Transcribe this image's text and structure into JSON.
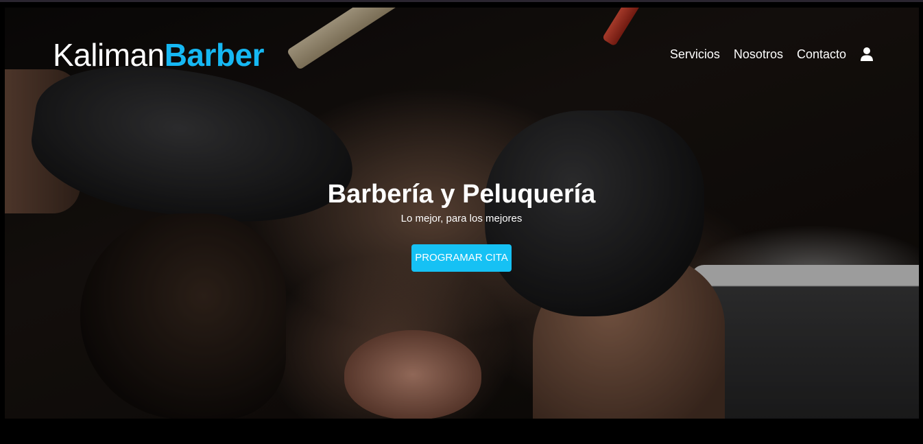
{
  "brand": {
    "name_light": "Kaliman",
    "name_bold": "Barber",
    "accent_color": "#16b8f3"
  },
  "nav": {
    "items": [
      {
        "label": "Servicios"
      },
      {
        "label": "Nosotros"
      },
      {
        "label": "Contacto"
      }
    ],
    "account_icon": "user-icon"
  },
  "hero": {
    "title": "Barbería y Peluquería",
    "subtitle": "Lo mejor, para los mejores",
    "cta_label": "PROGRAMAR CITA",
    "cta_color": "#16c1f4"
  }
}
